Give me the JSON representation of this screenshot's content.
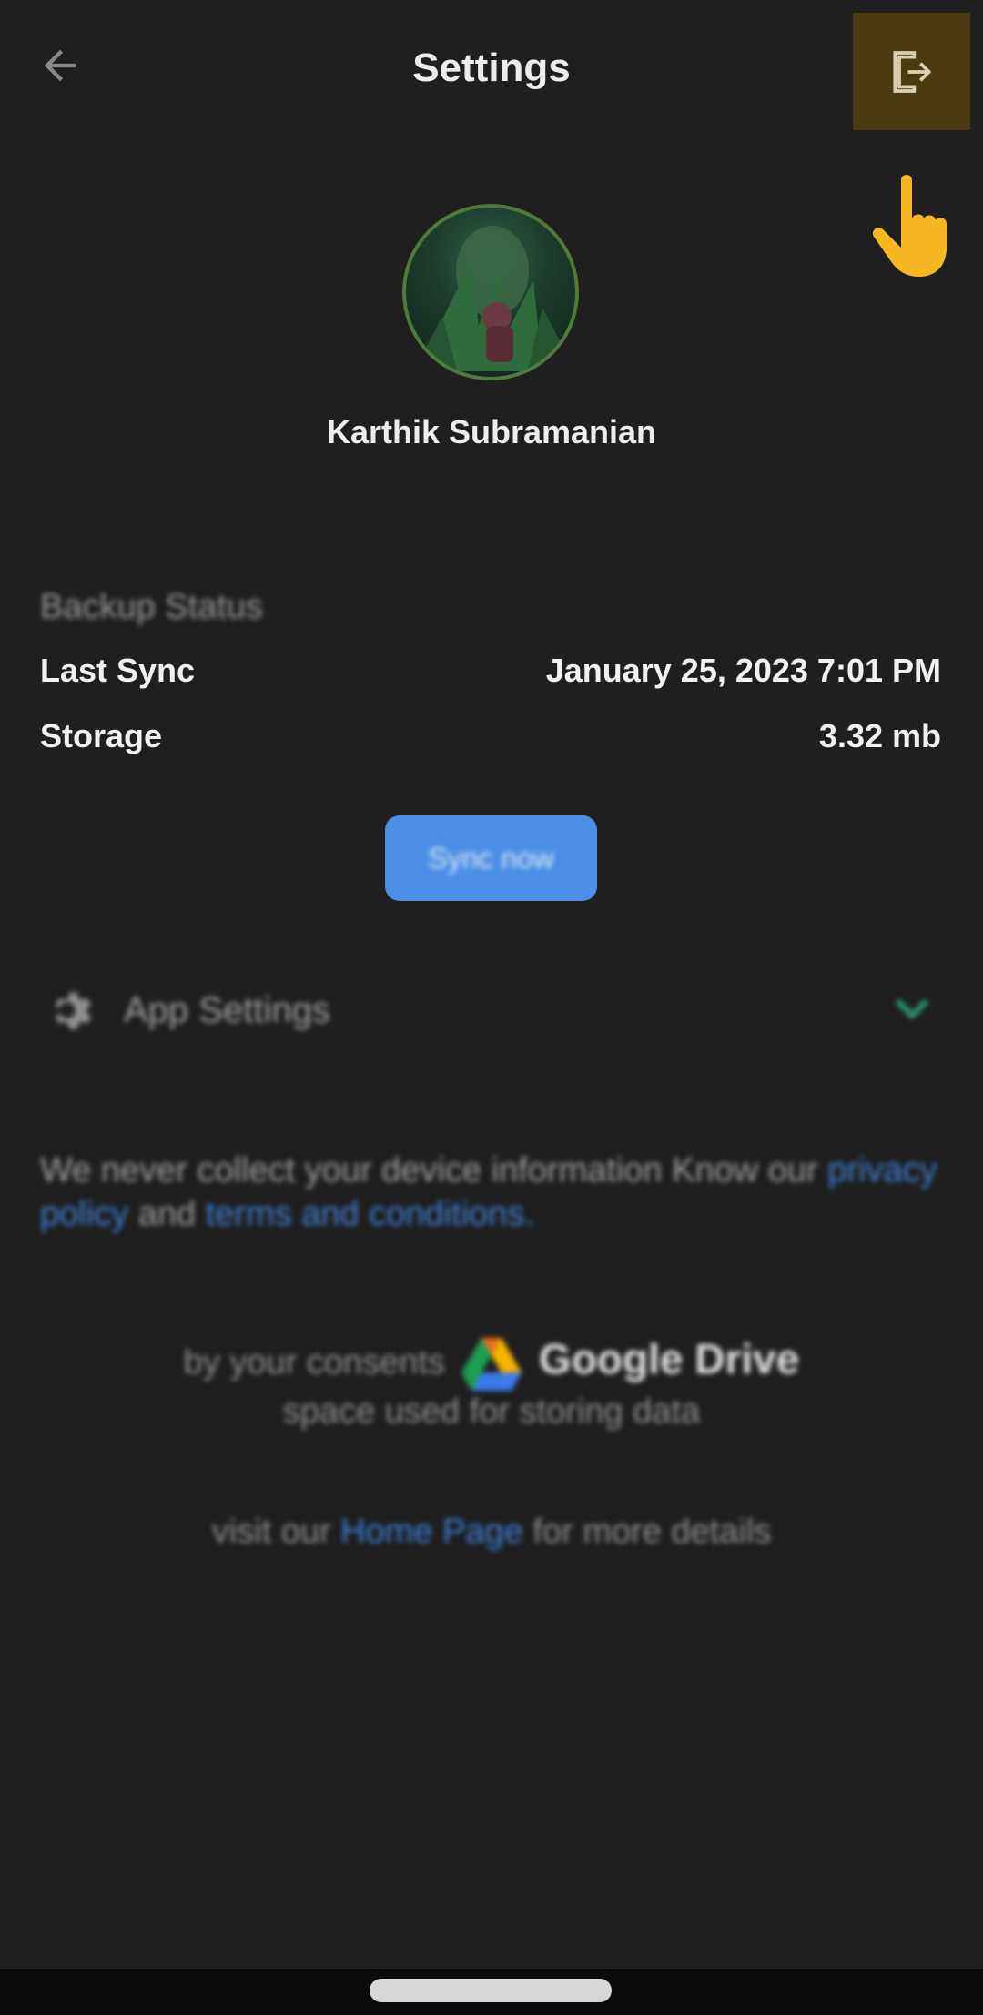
{
  "header": {
    "title": "Settings",
    "back_icon": "arrow-left-icon",
    "logout_icon": "logout-icon"
  },
  "profile": {
    "name": "Karthik Subramanian"
  },
  "backup": {
    "section_title": "Backup Status",
    "rows": [
      {
        "label": "Last Sync",
        "value": "January 25, 2023 7:01 PM"
      },
      {
        "label": "Storage",
        "value": "3.32 mb"
      }
    ],
    "sync_button": "Sync now"
  },
  "app_settings": {
    "label": "App Settings",
    "icon": "gear-icon",
    "chevron": "chevron-down-icon"
  },
  "privacy": {
    "text_before": "We never collect your device information Know our ",
    "privacy_link": "privacy policy",
    "text_and": " and ",
    "terms_link": "terms and conditions",
    "text_after": "."
  },
  "drive": {
    "prefix": "by your consents",
    "name": "Google Drive",
    "suffix": "space used for storing data"
  },
  "visit": {
    "prefix": "visit our ",
    "link": "Home Page",
    "suffix": " for more details"
  },
  "colors": {
    "background": "#1f1f1f",
    "accent": "#4a8ee6",
    "link": "#3d7fd6",
    "highlight": "#4a3c10"
  }
}
